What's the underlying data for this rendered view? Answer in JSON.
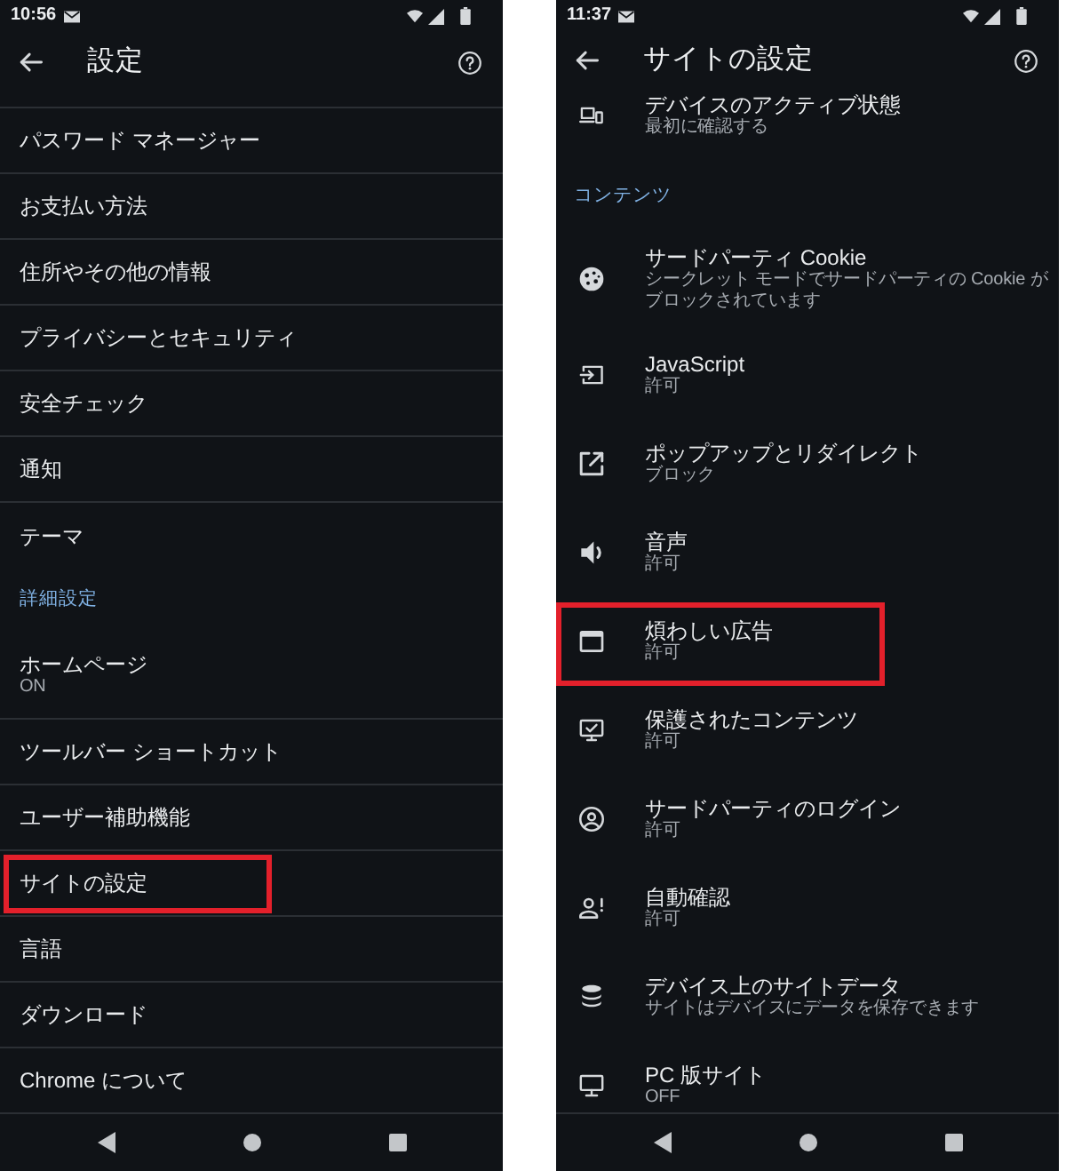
{
  "screens": [
    {
      "kind": "divided",
      "status_bar": {
        "time": "10:56"
      },
      "title": "設定",
      "list": [
        {
          "kind": "row",
          "title": "パスワード マネージャー",
          "highlighted": false
        },
        {
          "kind": "row",
          "title": "お支払い方法",
          "highlighted": false
        },
        {
          "kind": "row",
          "title": "住所やその他の情報",
          "highlighted": false
        },
        {
          "kind": "row",
          "title": "プライバシーとセキュリティ",
          "highlighted": false
        },
        {
          "kind": "row",
          "title": "安全チェック",
          "highlighted": false
        },
        {
          "kind": "row",
          "title": "通知",
          "highlighted": false
        },
        {
          "kind": "row",
          "title": "テーマ",
          "highlighted": false
        },
        {
          "kind": "section",
          "title": "詳細設定"
        },
        {
          "kind": "row",
          "title": "ホームページ",
          "subtitle": "ON",
          "highlighted": false
        },
        {
          "kind": "row",
          "title": "ツールバー ショートカット",
          "highlighted": false
        },
        {
          "kind": "row",
          "title": "ユーザー補助機能",
          "highlighted": false
        },
        {
          "kind": "row",
          "title": "サイトの設定",
          "highlighted": true
        },
        {
          "kind": "row",
          "title": "言語",
          "highlighted": false
        },
        {
          "kind": "row",
          "title": "ダウンロード",
          "highlighted": false
        },
        {
          "kind": "row",
          "title": "Chrome について",
          "highlighted": false
        }
      ]
    },
    {
      "kind": "icons",
      "status_bar": {
        "time": "11:37"
      },
      "title": "サイトの設定",
      "list": [
        {
          "kind": "row",
          "title": "デバイスのアクティブ状態",
          "subtitle": "最初に確認する",
          "highlighted": false
        },
        {
          "kind": "section",
          "title": "コンテンツ"
        },
        {
          "kind": "row",
          "title": "サードパーティ Cookie",
          "subtitle": "シークレット モードでサードパーティの Cookie がブロックされています",
          "highlighted": false
        },
        {
          "kind": "row",
          "title": "JavaScript",
          "subtitle": "許可",
          "highlighted": false
        },
        {
          "kind": "row",
          "title": "ポップアップとリダイレクト",
          "subtitle": "ブロック",
          "highlighted": false
        },
        {
          "kind": "row",
          "title": "音声",
          "subtitle": "許可",
          "highlighted": false
        },
        {
          "kind": "row",
          "title": "煩わしい広告",
          "subtitle": "許可",
          "highlighted": true
        },
        {
          "kind": "row",
          "title": "保護されたコンテンツ",
          "subtitle": "許可",
          "highlighted": false
        },
        {
          "kind": "row",
          "title": "サードパーティのログイン",
          "subtitle": "許可",
          "highlighted": false
        },
        {
          "kind": "row",
          "title": "自動確認",
          "subtitle": "許可",
          "highlighted": false
        },
        {
          "kind": "row",
          "title": "デバイス上のサイトデータ",
          "subtitle": "サイトはデバイスにデータを保存できます",
          "highlighted": false
        },
        {
          "kind": "row",
          "title": "PC 版サイト",
          "subtitle": "OFF",
          "highlighted": false
        }
      ]
    }
  ]
}
